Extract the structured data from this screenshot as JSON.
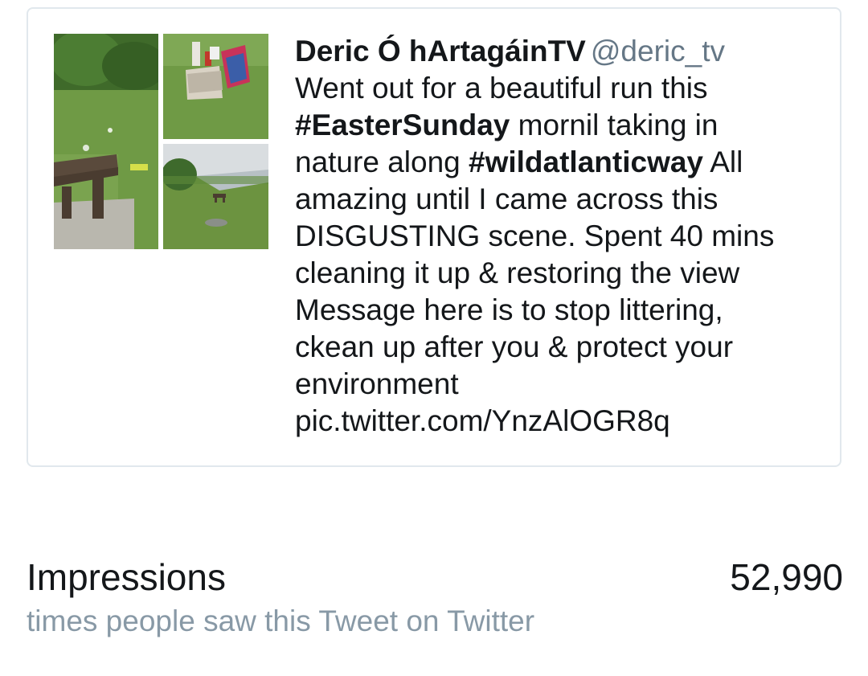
{
  "tweet": {
    "author_name": "Deric Ó hArtagáinTV",
    "author_handle": "@deric_tv",
    "media": [
      {
        "icon": "photo-bench-litter"
      },
      {
        "icon": "photo-litter-bags"
      },
      {
        "icon": "photo-lake-view"
      }
    ],
    "lines": [
      [
        {
          "t": "Went out for a beautiful run this"
        }
      ],
      [
        {
          "t": "#EasterSunday",
          "tag": true
        },
        {
          "t": " mornil taking in"
        }
      ],
      [
        {
          "t": "nature along "
        },
        {
          "t": "#wildatlanticway",
          "tag": true
        },
        {
          "t": " All"
        }
      ],
      [
        {
          "t": "amazing until I came across this"
        }
      ],
      [
        {
          "t": "DISGUSTING scene. Spent 40 mins"
        }
      ],
      [
        {
          "t": "cleaning it up & restoring the view"
        }
      ],
      [
        {
          "t": "Message here is to stop littering,"
        }
      ],
      [
        {
          "t": "ckean up after you & protect your"
        }
      ],
      [
        {
          "t": "environment"
        }
      ],
      [
        {
          "t": "pic.twitter.com/YnzAlOGR8q"
        }
      ]
    ]
  },
  "impressions": {
    "label": "Impressions",
    "value": "52,990",
    "description": "times people saw this Tweet on Twitter"
  },
  "colors": {
    "text": "#14171a",
    "secondary": "#657786",
    "muted": "#8899a6",
    "border": "#e1e8ed"
  }
}
